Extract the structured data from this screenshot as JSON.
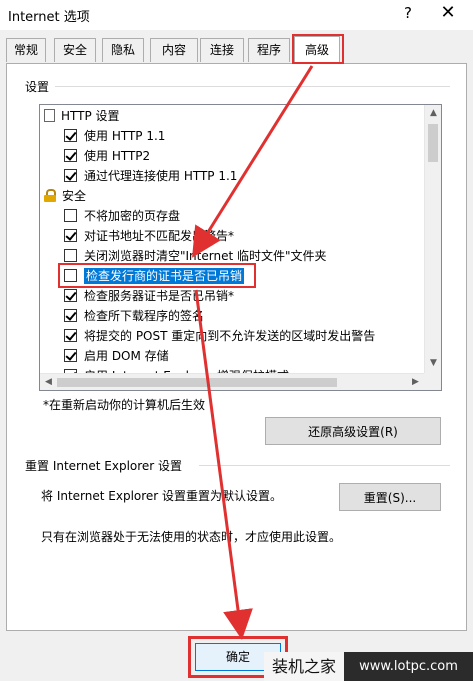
{
  "window": {
    "title": "Internet 选项",
    "help_glyph": "?",
    "close_glyph": "✕"
  },
  "tabs": [
    {
      "label": "常规"
    },
    {
      "label": "安全"
    },
    {
      "label": "隐私"
    },
    {
      "label": "内容"
    },
    {
      "label": "连接"
    },
    {
      "label": "程序"
    },
    {
      "label": "高级"
    }
  ],
  "active_tab": "高级",
  "settings": {
    "group_label": "设置",
    "items": [
      {
        "kind": "folder",
        "icon": "page-icon",
        "label": "HTTP 设置"
      },
      {
        "kind": "checkbox",
        "checked": true,
        "label": "使用 HTTP 1.1"
      },
      {
        "kind": "checkbox",
        "checked": true,
        "label": "使用 HTTP2"
      },
      {
        "kind": "checkbox",
        "checked": true,
        "label": "通过代理连接使用 HTTP 1.1"
      },
      {
        "kind": "folder",
        "icon": "lock-icon",
        "label": "安全"
      },
      {
        "kind": "checkbox",
        "checked": false,
        "label": "不将加密的页存盘"
      },
      {
        "kind": "checkbox",
        "checked": true,
        "label": "对证书地址不匹配发出警告*"
      },
      {
        "kind": "checkbox",
        "checked": false,
        "label": "关闭浏览器时清空\"Internet 临时文件\"文件夹"
      },
      {
        "kind": "checkbox",
        "checked": false,
        "label": "检查发行商的证书是否已吊销",
        "selected": true
      },
      {
        "kind": "checkbox",
        "checked": true,
        "label": "检查服务器证书是否已吊销*"
      },
      {
        "kind": "checkbox",
        "checked": true,
        "label": "检查所下载程序的签名"
      },
      {
        "kind": "checkbox",
        "checked": true,
        "label": "将提交的 POST 重定向到不允许发送的区域时发出警告"
      },
      {
        "kind": "checkbox",
        "checked": true,
        "label": "启用 DOM 存储"
      },
      {
        "kind": "checkbox",
        "checked": true,
        "label": "启用 Internet Explorer 增强保护模式"
      }
    ],
    "restart_note": "*在重新启动你的计算机后生效",
    "restore_button": "还原高级设置(R)"
  },
  "reset": {
    "group_label": "重置 Internet Explorer 设置",
    "description": "将 Internet Explorer 设置重置为默认设置。",
    "button": "重置(S)...",
    "note": "只有在浏览器处于无法使用的状态时，才应使用此设置。"
  },
  "footer": {
    "ok_button": "确定"
  },
  "watermark": {
    "left": "装机之家",
    "right": "www.lotpc.com"
  },
  "colors": {
    "selection": "#0078d7",
    "annotation_red": "#e03030"
  }
}
